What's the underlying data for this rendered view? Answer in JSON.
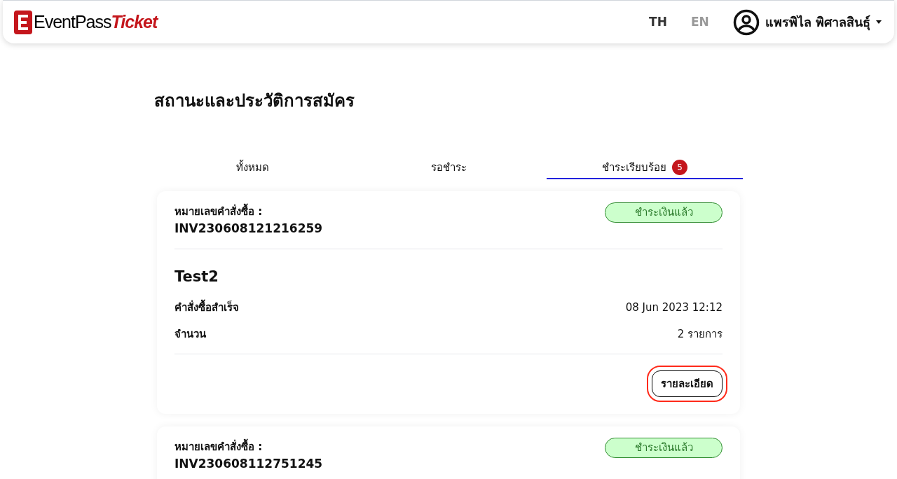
{
  "header": {
    "logo": {
      "brand": "EventPass",
      "accent": "Ticket"
    },
    "languages": [
      {
        "label": "TH",
        "selected": true
      },
      {
        "label": "EN",
        "selected": false
      }
    ],
    "user": {
      "name": "แพรพิไล พิศาลสินธุ์"
    }
  },
  "title": "สถานะและประวัติการสมัคร",
  "tabs": [
    {
      "label": "ทั้งหมด",
      "selected": false
    },
    {
      "label": "รอชำระ",
      "selected": false
    },
    {
      "label": "ชำระเรียบร้อย",
      "selected": true,
      "badge": "5"
    }
  ],
  "orders": [
    {
      "number_label": "หมายเลขคำสั่งซื้อ :",
      "number": "INV230608121216259",
      "status": "ชำระเงินแล้ว",
      "event": "Test2",
      "rows": [
        {
          "label": "คำสั่งซื้อสำเร็จ",
          "value": "08 Jun 2023 12:12"
        },
        {
          "label": "จำนวน",
          "value": "2 รายการ"
        }
      ],
      "button": {
        "label": "รายละเอียด",
        "highlighted": true
      }
    },
    {
      "number_label": "หมายเลขคำสั่งซื้อ :",
      "number": "INV230608112751245",
      "status": "ชำระเงินแล้ว"
    }
  ]
}
